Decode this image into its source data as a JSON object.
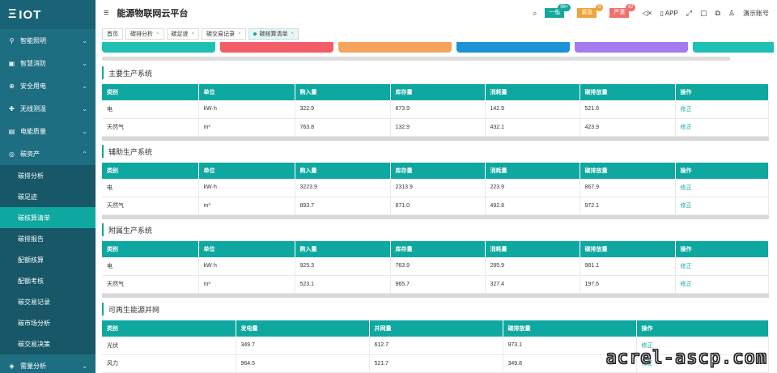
{
  "app": {
    "logo": "IOT",
    "title": "能源物联网云平台"
  },
  "sidebar": {
    "items": [
      {
        "label": "智能照明"
      },
      {
        "label": "智慧消防"
      },
      {
        "label": "安全用电"
      },
      {
        "label": "无线测温"
      },
      {
        "label": "电能质量"
      },
      {
        "label": "碳资产"
      }
    ],
    "sub_items": [
      {
        "label": "碳排分析"
      },
      {
        "label": "碳足迹"
      },
      {
        "label": "碳核算清单"
      },
      {
        "label": "碳排报告"
      },
      {
        "label": "配额核算"
      },
      {
        "label": "配额考核"
      },
      {
        "label": "碳交易记录"
      },
      {
        "label": "碳市场分析"
      },
      {
        "label": "碳交易决策"
      }
    ],
    "bottom_item": {
      "label": "需量分析"
    }
  },
  "header": {
    "alerts": [
      {
        "label": "一般",
        "count": "99+",
        "color": "#14a89c",
        "badge_color": "#14a89c"
      },
      {
        "label": "紧急",
        "count": "0",
        "color": "#f0a23b",
        "badge_color": "#f0a23b"
      },
      {
        "label": "严重",
        "count": "42",
        "color": "#f07070",
        "badge_color": "#f07070"
      }
    ],
    "app_label": "APP",
    "user_label": "演示账号"
  },
  "tabs": [
    {
      "label": "首页"
    },
    {
      "label": "碳排分析"
    },
    {
      "label": "碳足迹"
    },
    {
      "label": "碳交易记录"
    },
    {
      "label": "碳核算清单"
    }
  ],
  "cards": [
    "#1fc0b4",
    "#f25d67",
    "#f5a35d",
    "#1b93d6",
    "#a67bf0",
    "#1fc0b4"
  ],
  "tables": [
    {
      "title": "主要生产系统",
      "headers": [
        "类别",
        "单位",
        "购入量",
        "库存量",
        "消耗量",
        "碳排放量",
        "操作"
      ],
      "rows": [
        [
          "电",
          "kW·h",
          "322.9",
          "873.9",
          "142.9",
          "521.6",
          "修正"
        ],
        [
          "天然气",
          "m³",
          "763.8",
          "132.9",
          "432.1",
          "423.9",
          "修正"
        ]
      ]
    },
    {
      "title": "辅助生产系统",
      "headers": [
        "类别",
        "单位",
        "购入量",
        "库存量",
        "消耗量",
        "碳排放量",
        "操作"
      ],
      "rows": [
        [
          "电",
          "kW·h",
          "3223.9",
          "2313.9",
          "223.9",
          "867.9",
          "修正"
        ],
        [
          "天然气",
          "m³",
          "893.7",
          "871.0",
          "492.8",
          "972.1",
          "修正"
        ]
      ]
    },
    {
      "title": "附属生产系统",
      "headers": [
        "类别",
        "单位",
        "购入量",
        "库存量",
        "消耗量",
        "碳排放量",
        "操作"
      ],
      "rows": [
        [
          "电",
          "kW·h",
          "925.3",
          "763.9",
          "285.9",
          "981.1",
          "修正"
        ],
        [
          "天然气",
          "m³",
          "523.1",
          "965.7",
          "327.4",
          "197.6",
          "修正"
        ]
      ]
    },
    {
      "title": "可再生能源并网",
      "headers": [
        "类别",
        "发电量",
        "并网量",
        "碳排放量",
        "操作"
      ],
      "rows": [
        [
          "光伏",
          "349.7",
          "612.7",
          "973.1",
          "修正"
        ],
        [
          "风力",
          "964.5",
          "521.7",
          "349.8",
          "修正"
        ]
      ]
    }
  ],
  "watermark": "acrel-ascp.com"
}
